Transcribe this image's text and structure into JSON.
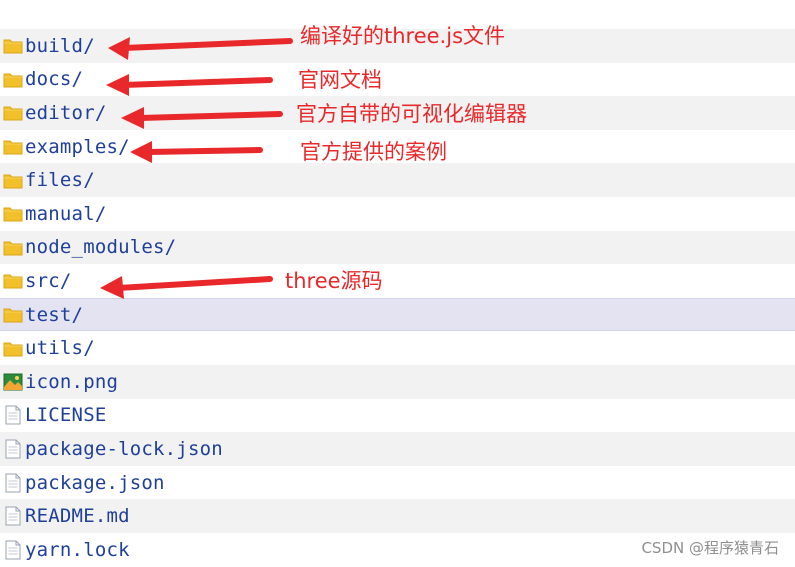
{
  "files": [
    {
      "name": "build/",
      "icon": "folder-icon"
    },
    {
      "name": "docs/",
      "icon": "folder-icon"
    },
    {
      "name": "editor/",
      "icon": "folder-icon"
    },
    {
      "name": "examples/",
      "icon": "folder-icon"
    },
    {
      "name": "files/",
      "icon": "folder-icon"
    },
    {
      "name": "manual/",
      "icon": "folder-icon"
    },
    {
      "name": "node_modules/",
      "icon": "folder-icon"
    },
    {
      "name": "src/",
      "icon": "folder-icon"
    },
    {
      "name": "test/",
      "icon": "folder-icon",
      "selected": true
    },
    {
      "name": "utils/",
      "icon": "folder-icon"
    },
    {
      "name": "icon.png",
      "icon": "image-icon"
    },
    {
      "name": "LICENSE",
      "icon": "file-icon"
    },
    {
      "name": "package-lock.json",
      "icon": "file-icon"
    },
    {
      "name": "package.json",
      "icon": "file-icon"
    },
    {
      "name": "README.md",
      "icon": "file-icon"
    },
    {
      "name": "yarn.lock",
      "icon": "file-icon"
    }
  ],
  "annotations": {
    "build": "编译好的three.js文件",
    "docs": "官网文档",
    "editor": "官方自带的可视化编辑器",
    "examples": "官方提供的案例",
    "src": "three源码"
  },
  "watermark": "CSDN @程序猿青石",
  "colors": {
    "filename": "#1f3f9a",
    "annotation": "#e8282a",
    "folder": "#f2c02a",
    "selected_row": "#e3e3f1",
    "alt_row": "#f2f2f2"
  }
}
